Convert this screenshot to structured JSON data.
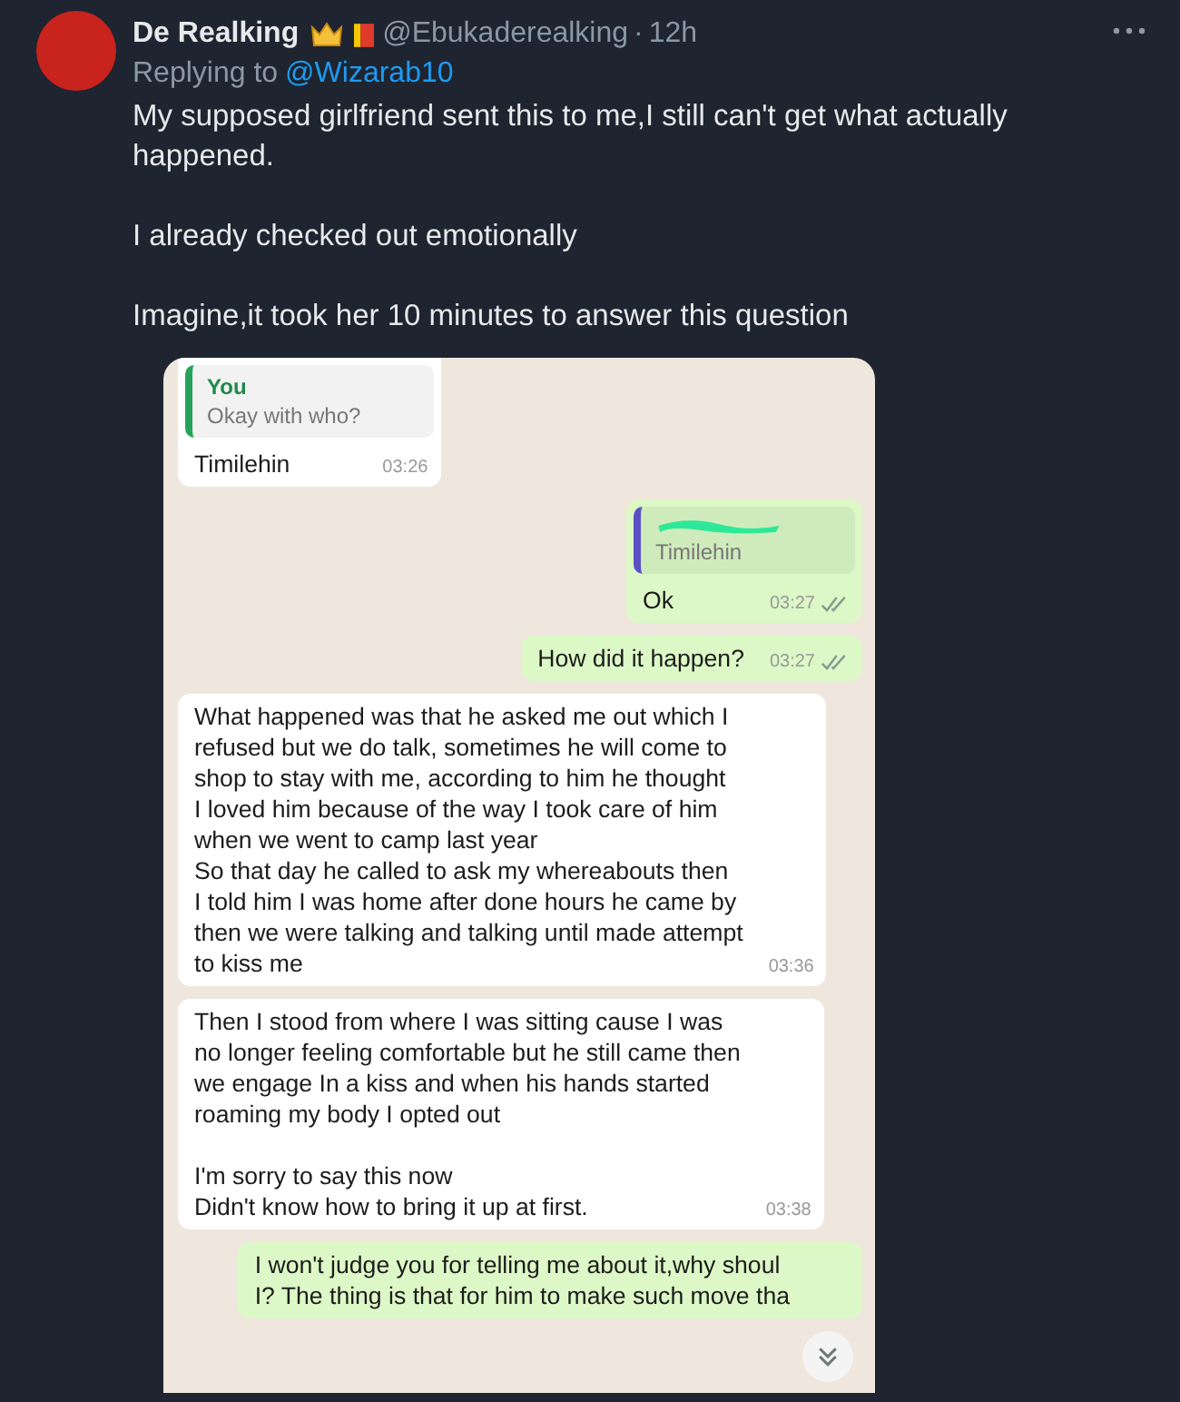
{
  "tweet": {
    "author": "De Realking",
    "handle": "@Ebukaderealking",
    "separator": "·",
    "time": "12h",
    "replying_label": "Replying to",
    "replying_to": "@Wizarab10",
    "paragraphs": [
      "My supposed girlfriend sent this to me,I still can't get what actually happened.",
      "I already checked out emotionally",
      "Imagine,it took her 10 minutes to answer this question"
    ]
  },
  "chat": {
    "messages": [
      {
        "kind": "received",
        "quote": {
          "author": "You",
          "text": "Okay with who?",
          "color": "#25a35a",
          "redacted": false
        },
        "text": "Timilehin",
        "time": "03:26"
      },
      {
        "kind": "sent",
        "quote": {
          "text": "Timilehin",
          "color": "#5b4fc4",
          "redacted": true
        },
        "text": "Ok",
        "time": "03:27"
      },
      {
        "kind": "sent",
        "text": "How did it happen?",
        "time": "03:27"
      },
      {
        "kind": "received",
        "text": "What happened was  that  he asked me out which I\nrefused but we do talk, sometimes he will come to\nshop to stay with me, according to him he thought\nI loved him because of the way I took care of him\nwhen we went to camp last year\nSo that day he called to ask my whereabouts then\nI told him I was home after done hours he came by\nthen we were talking and talking until made attempt\nto kiss me",
        "time": "03:36"
      },
      {
        "kind": "received",
        "text": "Then I stood from where I was sitting cause I was\nno longer feeling comfortable but he still came then\nwe engage In a kiss and when his hands started\nroaming my body I opted out\n\nI'm sorry to say this now\nDidn't know how to bring it up at first.",
        "time": "03:38"
      },
      {
        "kind": "sent",
        "text": "I won't judge you for telling me about it,why shoul\nI?  The thing is that for him to make such move tha"
      }
    ]
  }
}
